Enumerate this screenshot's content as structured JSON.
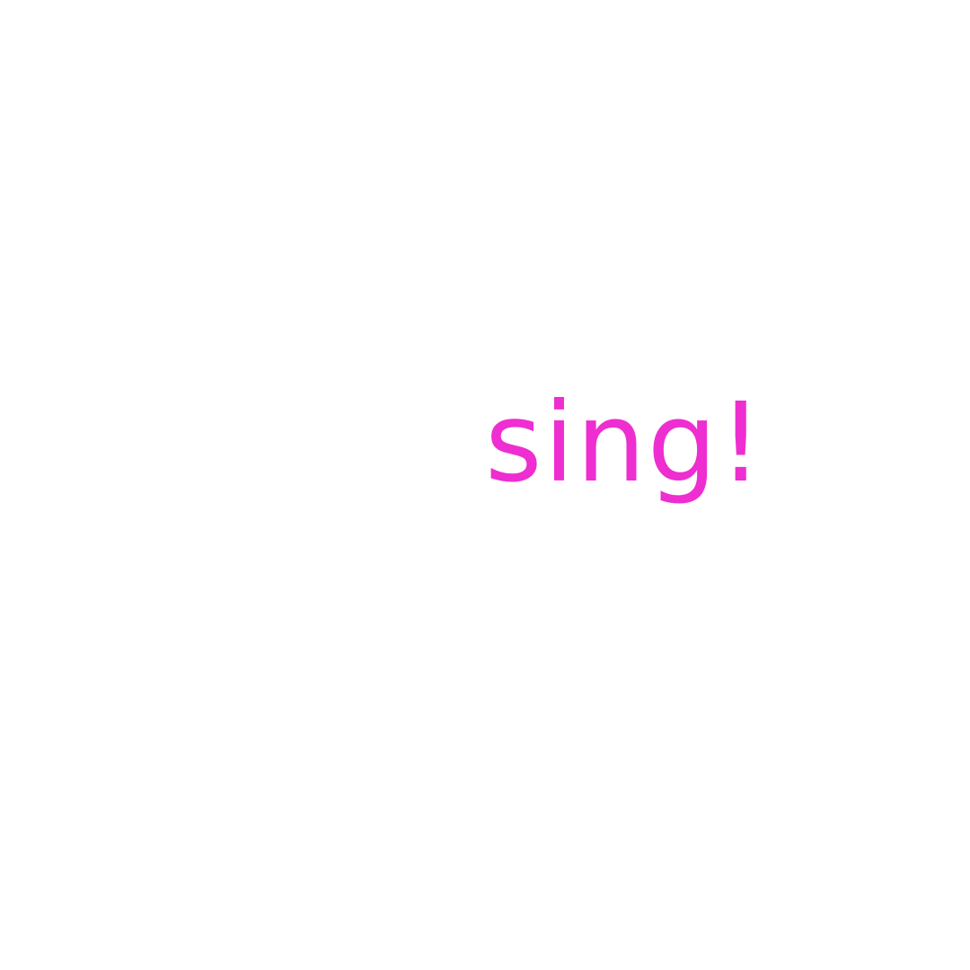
{
  "text": "sing!",
  "colors": {
    "background": "#ffffff",
    "text": "#EE2ED0"
  }
}
